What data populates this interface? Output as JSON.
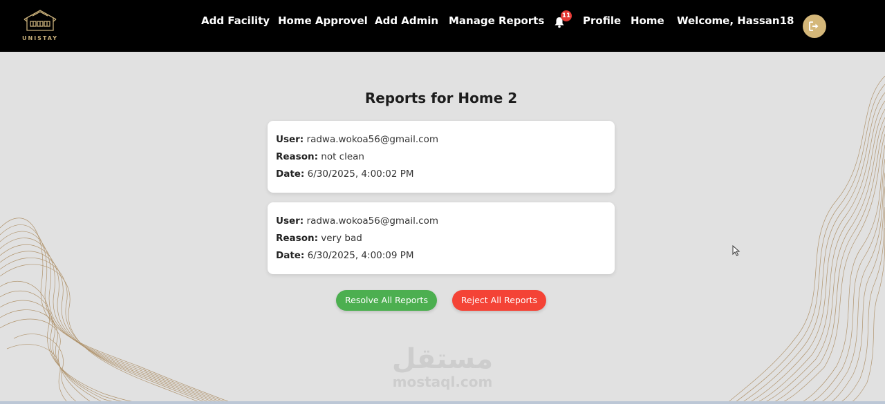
{
  "brand": {
    "logo_text": "UNISTAY"
  },
  "nav": {
    "items": [
      {
        "label": "Add Facility"
      },
      {
        "label": "Home Approvel"
      },
      {
        "label": "Add Admin"
      },
      {
        "label": "Manage Reports"
      },
      {
        "label": "Profile"
      },
      {
        "label": "Home"
      }
    ],
    "notification_count": "11",
    "welcome": "Welcome, Hassan18"
  },
  "main": {
    "title": "Reports for Home 2",
    "labels": {
      "user": "User:",
      "reason": "Reason:",
      "date": "Date:"
    },
    "reports": [
      {
        "user": "radwa.wokoa56@gmail.com",
        "reason": "not clean",
        "date": "6/30/2025, 4:00:02 PM"
      },
      {
        "user": "radwa.wokoa56@gmail.com",
        "reason": "very bad",
        "date": "6/30/2025, 4:00:09 PM"
      }
    ],
    "resolve_label": "Resolve All Reports",
    "reject_label": "Reject All Reports"
  },
  "watermark": {
    "arabic": "مستقل",
    "latin": "mostaql.com"
  },
  "colors": {
    "navbar_bg": "#000000",
    "page_bg": "#e1e1e1",
    "accent_gold": "#d4b779",
    "badge_red": "#e53935",
    "resolve_green": "#4caf50",
    "reject_red": "#f44336"
  },
  "icons": {
    "notification": "bell-icon",
    "logout": "sign-out-icon"
  }
}
